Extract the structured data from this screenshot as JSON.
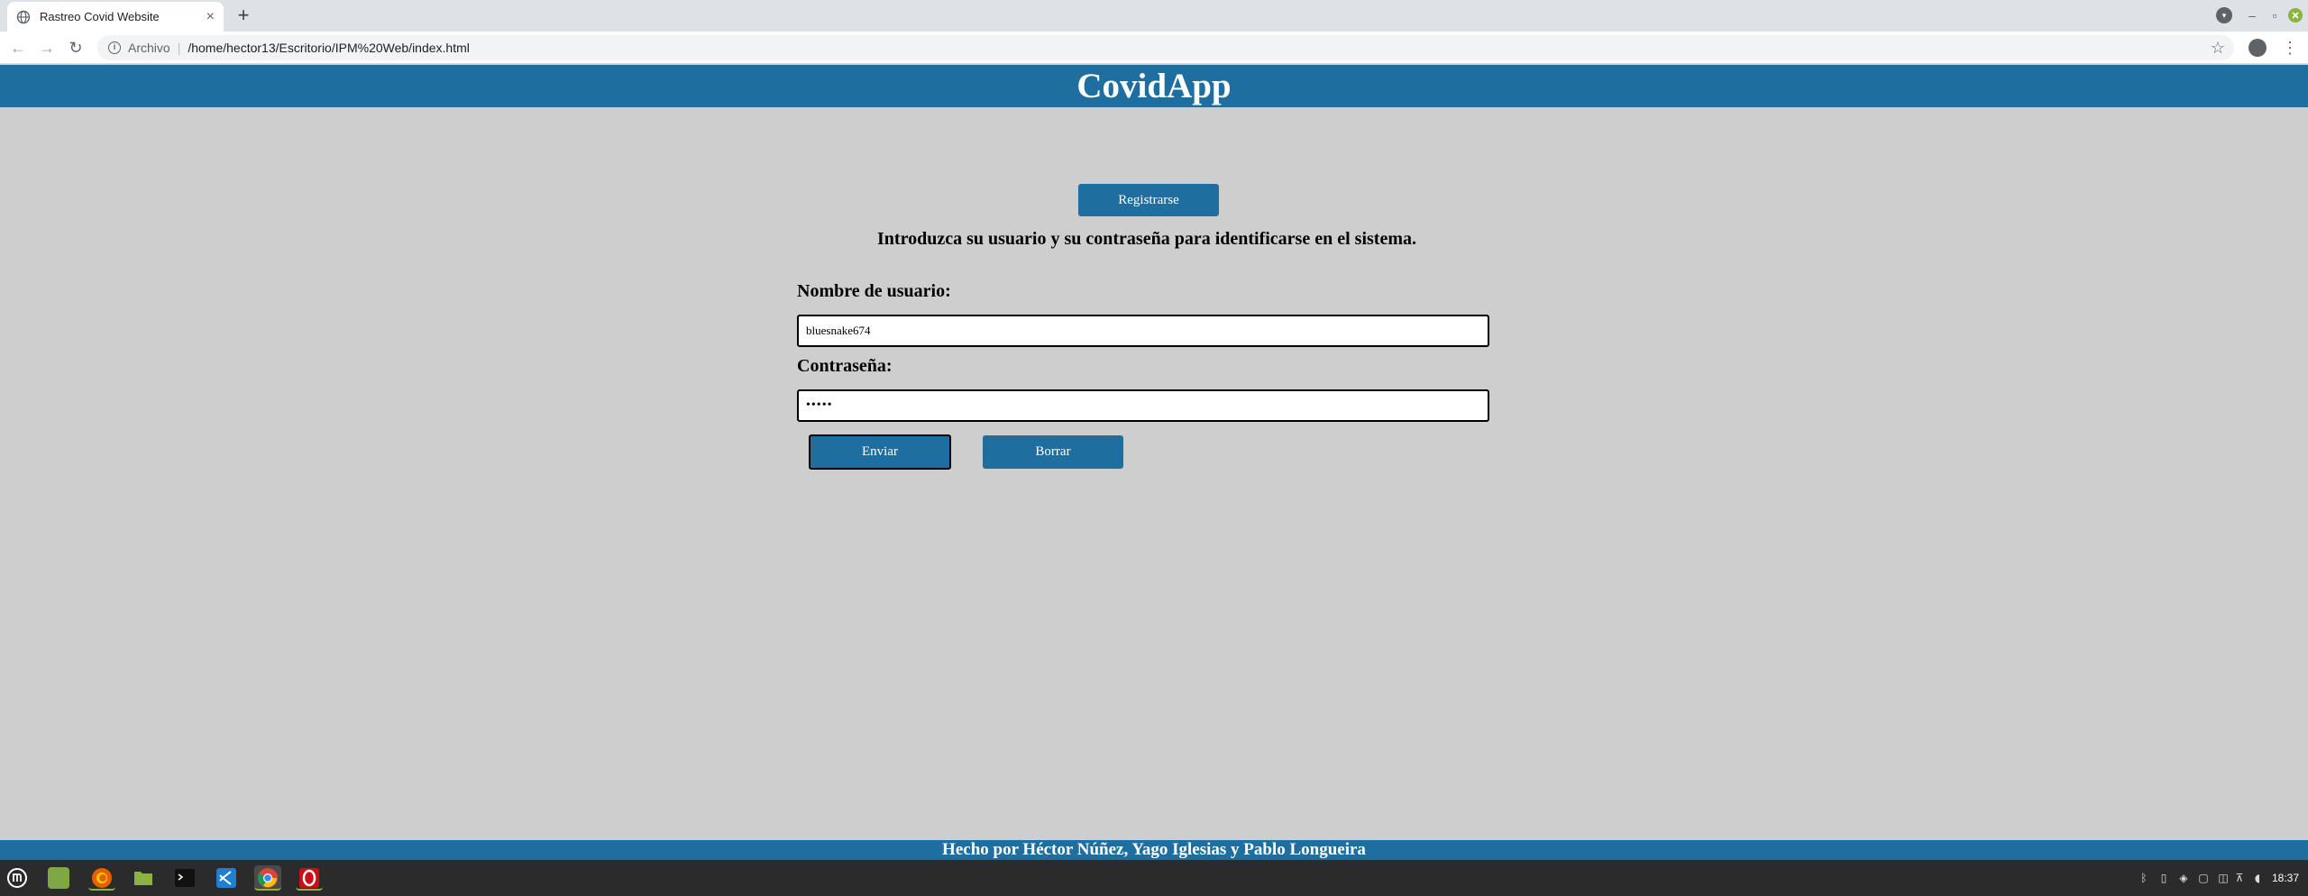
{
  "browser": {
    "tab_title": "Rastreo Covid Website",
    "tab_close": "×",
    "new_tab": "+",
    "address_scheme": "Archivo",
    "address_url": "/home/hector13/Escritorio/IPM%20Web/index.html",
    "window_controls": {
      "minimize": "–",
      "maximize": "▫",
      "close": "×"
    }
  },
  "page": {
    "brand": "CovidApp",
    "register_button": "Registrarse",
    "instructions": "Introduzca su usuario y su contraseña para identificarse en el sistema.",
    "username_label": "Nombre de usuario:",
    "username_value": "bluesnake674",
    "password_label": "Contraseña:",
    "password_mask": "•••••",
    "send_button": "Enviar",
    "clear_button": "Borrar",
    "footer": "Hecho por Héctor Núñez, Yago Iglesias y Pablo Longueira"
  },
  "taskbar": {
    "apps": [
      "menu-icon",
      "show-desktop-icon",
      "firefox-icon",
      "files-icon",
      "terminal-icon",
      "vscode-icon",
      "chrome-icon",
      "opera-icon"
    ],
    "clock": "18:37"
  },
  "colors": {
    "primary": "#1e6f9f",
    "page_background": "#cecece",
    "taskbar": "#2b2b2b"
  }
}
